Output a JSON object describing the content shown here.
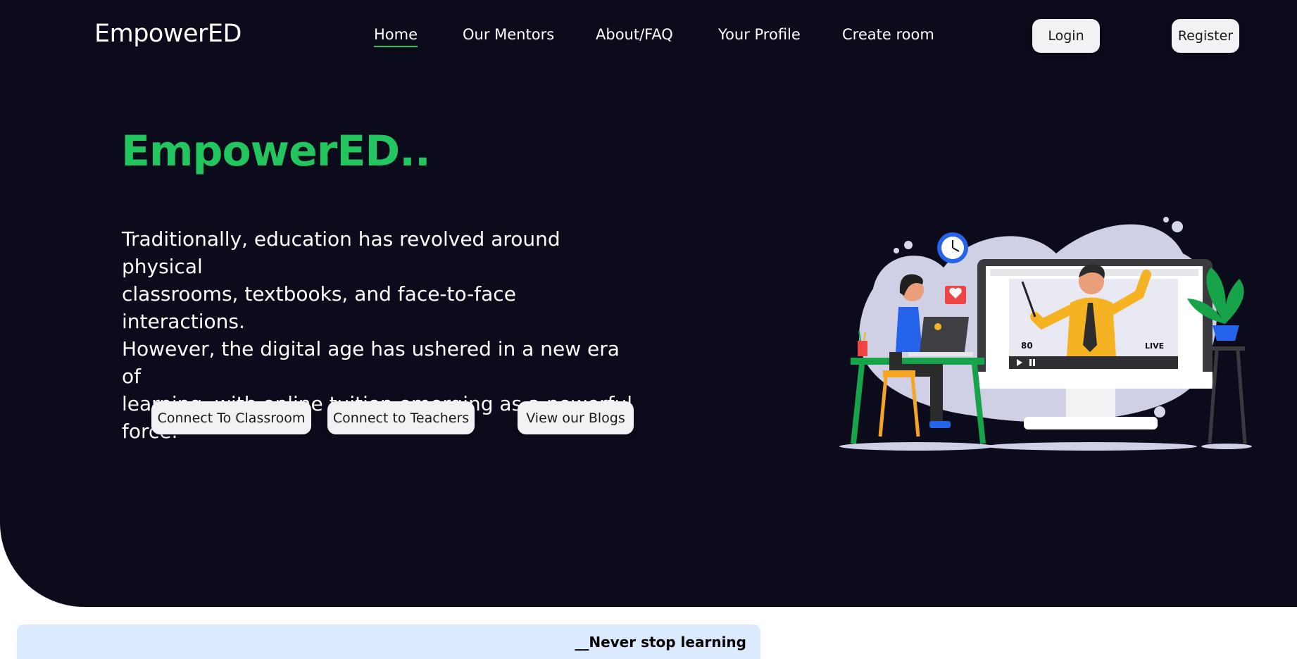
{
  "brand": "EmpowerED",
  "nav": {
    "items": [
      "Home",
      "Our Mentors",
      "About/FAQ",
      "Your Profile",
      "Create room"
    ],
    "login": "Login",
    "register": "Register"
  },
  "hero": {
    "title": "EmpowerED..",
    "lines": [
      "Traditionally, education has revolved around physical",
      "classrooms, textbooks, and face-to-face interactions.",
      "However, the digital age has ushered in a new era of",
      "learning, with online tuition emerging as a powerful force."
    ],
    "buttons": [
      "Connect To Classroom",
      "Connect to Teachers",
      "View our Blogs"
    ]
  },
  "illustration": {
    "viewer_count": "80",
    "live_label": "LIVE"
  },
  "banner": {
    "text": "__Never stop learning"
  },
  "colors": {
    "hero_bg": "#0b0b1c",
    "accent": "#22c55e",
    "banner_bg": "#dbeafe"
  }
}
